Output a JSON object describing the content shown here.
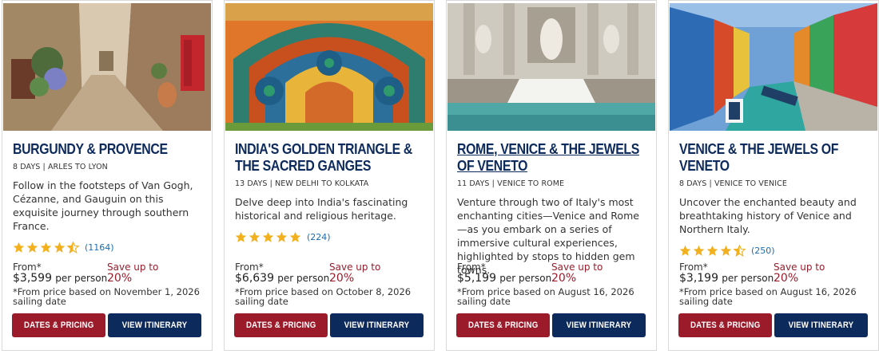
{
  "colors": {
    "title_navy": "#0d2a5c",
    "save_red": "#9b1b2a",
    "star_gold": "#f2b01e",
    "count_blue": "#1a6db3",
    "button_red": "#9b1b2a",
    "button_navy": "#0d2a5c"
  },
  "cards": [
    {
      "title": "BURGUNDY & PROVENCE",
      "meta": "8 DAYS | ARLES TO LYON",
      "description": "Follow in the footsteps of Van Gogh, Cézanne, and Gauguin on this exquisite journey through southern France.",
      "rating": 4.5,
      "review_count": "(1164)",
      "from_label": "From*",
      "price": "$3,599",
      "per_person": "per person",
      "save_label": "Save up to",
      "save_percent": "20%",
      "note": "*From price based on November 1, 2026 sailing date",
      "dates_button": "DATES & PRICING",
      "itinerary_button": "VIEW ITINERARY"
    },
    {
      "title": "INDIA'S GOLDEN TRIANGLE & THE SACRED GANGES",
      "meta": "13 DAYS | NEW DELHI TO KOLKATA",
      "description": "Delve deep into India's fascinating historical and religious heritage.",
      "rating": 5,
      "review_count": "(224)",
      "from_label": "From*",
      "price": "$6,639",
      "per_person": "per person",
      "save_label": "Save up to",
      "save_percent": "20%",
      "note": "*From price based on October 8, 2026 sailing date",
      "dates_button": "DATES & PRICING",
      "itinerary_button": "VIEW ITINERARY"
    },
    {
      "title": "ROME, VENICE & THE JEWELS OF VENETO",
      "meta": "11 DAYS | VENICE TO ROME",
      "description": "Venture through two of Italy's most enchanting cities—Venice and Rome—as you embark on a series of immersive cultural experiences, highlighted by stops to hidden gem towns.",
      "rating": null,
      "review_count": "",
      "from_label": "From*",
      "price": "$5,199",
      "per_person": "per person",
      "save_label": "Save up to",
      "save_percent": "20%",
      "note": "*From price based on August 16, 2026 sailing date",
      "dates_button": "DATES & PRICING",
      "itinerary_button": "VIEW ITINERARY"
    },
    {
      "title": "VENICE & THE JEWELS OF VENETO",
      "meta": "8 DAYS | VENICE TO VENICE",
      "description": "Uncover the enchanted beauty and breathtaking history of Venice and Northern Italy.",
      "rating": 4.5,
      "review_count": "(250)",
      "from_label": "From*",
      "price": "$3,199",
      "per_person": "per person",
      "save_label": "Save up to",
      "save_percent": "20%",
      "note": "*From price based on August 16, 2026 sailing date",
      "dates_button": "DATES & PRICING",
      "itinerary_button": "VIEW ITINERARY"
    }
  ]
}
